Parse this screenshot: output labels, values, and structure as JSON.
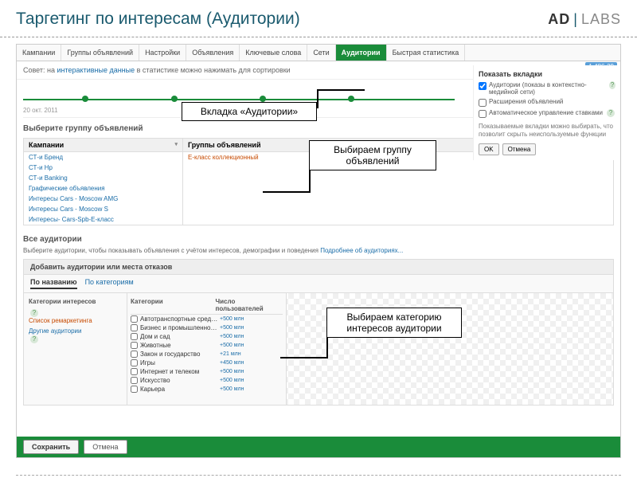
{
  "slide": {
    "title": "Таргетинг по интересам (Аудитории)"
  },
  "logo": {
    "a": "AD",
    "b": "LABS"
  },
  "tabs": [
    "Кампании",
    "Группы объявлений",
    "Настройки",
    "Объявления",
    "Ключевые слова",
    "Сети",
    "Аудитории",
    "Быстрая статистика"
  ],
  "tip": {
    "pre": "Совет: на ",
    "link": "интерактивные данные",
    "post": " в статистике можно нажимать для сортировки"
  },
  "timeline": {
    "date": "20 окт. 2011"
  },
  "right": {
    "title": "Показать вкладки",
    "items": [
      {
        "label": "Аудитории (показы в контекстно-медийной сети)",
        "checked": true
      },
      {
        "label": "Расширения объявлений",
        "checked": false
      },
      {
        "label": "Автоматическое управление ставками",
        "checked": false
      }
    ],
    "note": "Показываемые вкладки можно выбирать, что позволит скрыть неиспользуемые функции",
    "ok": "OK",
    "cancel": "Отмена",
    "badge": "1 486-39"
  },
  "sec1_title": "Выберите группу объявлений",
  "col1_head": "Кампании",
  "col2_head": "Группы объявлений",
  "campaigns": [
    "СТ-и Бренд",
    "СТ-и Нр",
    "СТ-и Banking",
    "Графические объявления",
    "Интересы Cars - Moscow AMG",
    "Интересы Cars - Moscow S",
    "Интересы- Cars-Spb-E-класс"
  ],
  "groups_sel": "E-класс коллекционный",
  "all_aud": {
    "title": "Все аудитории",
    "sub_pre": "Выберите аудитории, чтобы показывать объявления с учётом интересов, демографии и поведения",
    "sub_link": "Подробнее об аудиториях..."
  },
  "aud_head": "Добавить аудитории или места отказов",
  "aud_tabs": [
    "По названию",
    "По категориям"
  ],
  "cat_head": "Категории интересов",
  "cat_link1": "Список ремаркетинга",
  "cat_link2": "Другие аудитории",
  "cat_cols": {
    "a": "Категории",
    "b": "Число пользователей"
  },
  "cats": [
    {
      "n": "Автотранспортные средства",
      "v": "+500 млн"
    },
    {
      "n": "Бизнес и промышленность",
      "v": "+500 млн"
    },
    {
      "n": "Дом и сад",
      "v": "+500 млн"
    },
    {
      "n": "Животные",
      "v": "+500 млн"
    },
    {
      "n": "Закон и государство",
      "v": "+21 млн"
    },
    {
      "n": "Игры",
      "v": "+450 млн"
    },
    {
      "n": "Интернет и телеком",
      "v": "+500 млн"
    },
    {
      "n": "Искусство",
      "v": "+500 млн"
    },
    {
      "n": "Карьера",
      "v": "+500 млн"
    }
  ],
  "bottom": {
    "save": "Сохранить",
    "cancel": "Отмена"
  },
  "callouts": {
    "c1": "Вкладка «Аудитории»",
    "c2": "Выбираем группу объявлений",
    "c3": "Выбираем категорию интересов аудитории"
  }
}
